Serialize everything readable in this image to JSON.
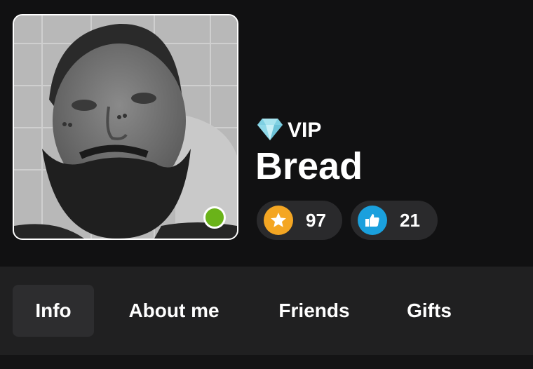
{
  "profile": {
    "badge_label": "VIP",
    "badge_icon": "diamond-icon",
    "name": "Bread",
    "online": true,
    "online_color": "#6ab319"
  },
  "stats": {
    "stars": {
      "icon": "star-icon",
      "value": "97",
      "color": "#f4a623"
    },
    "likes": {
      "icon": "thumbs-up-icon",
      "value": "21",
      "color": "#1aa0dd"
    }
  },
  "tabs": [
    {
      "label": "Info",
      "active": true
    },
    {
      "label": "About me",
      "active": false
    },
    {
      "label": "Friends",
      "active": false
    },
    {
      "label": "Gifts",
      "active": false
    }
  ]
}
